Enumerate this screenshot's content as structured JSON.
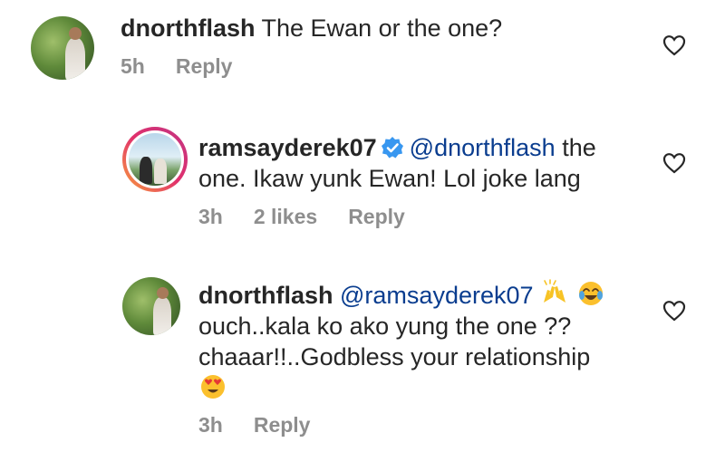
{
  "comments": [
    {
      "username": "dnorthflash",
      "text": "The Ewan or the one?",
      "time": "5h",
      "reply": "Reply"
    },
    {
      "username": "ramsayderek07",
      "mention": "@dnorthflash",
      "text_line1_rest": "the",
      "text_line2": "one. Ikaw yunk Ewan! Lol joke lang",
      "time": "3h",
      "likes": "2 likes",
      "reply": "Reply"
    },
    {
      "username": "dnorthflash",
      "mention": "@ramsayderek07",
      "text_line2": "ouch..kala ko ako yung the one ??",
      "text_line3": "chaaar!!..Godbless your relationship",
      "time": "3h",
      "reply": "Reply"
    }
  ],
  "icons": {
    "like": "heart-outline-icon",
    "verified": "verified-badge-icon",
    "emoji_raised_hands": "raising-hands-emoji",
    "emoji_laughing": "tears-of-joy-emoji",
    "emoji_heart_eyes": "heart-eyes-emoji"
  },
  "colors": {
    "text": "#262626",
    "meta": "#8e8e8e",
    "mention": "#0a3d8f",
    "verified": "#3897f0"
  }
}
